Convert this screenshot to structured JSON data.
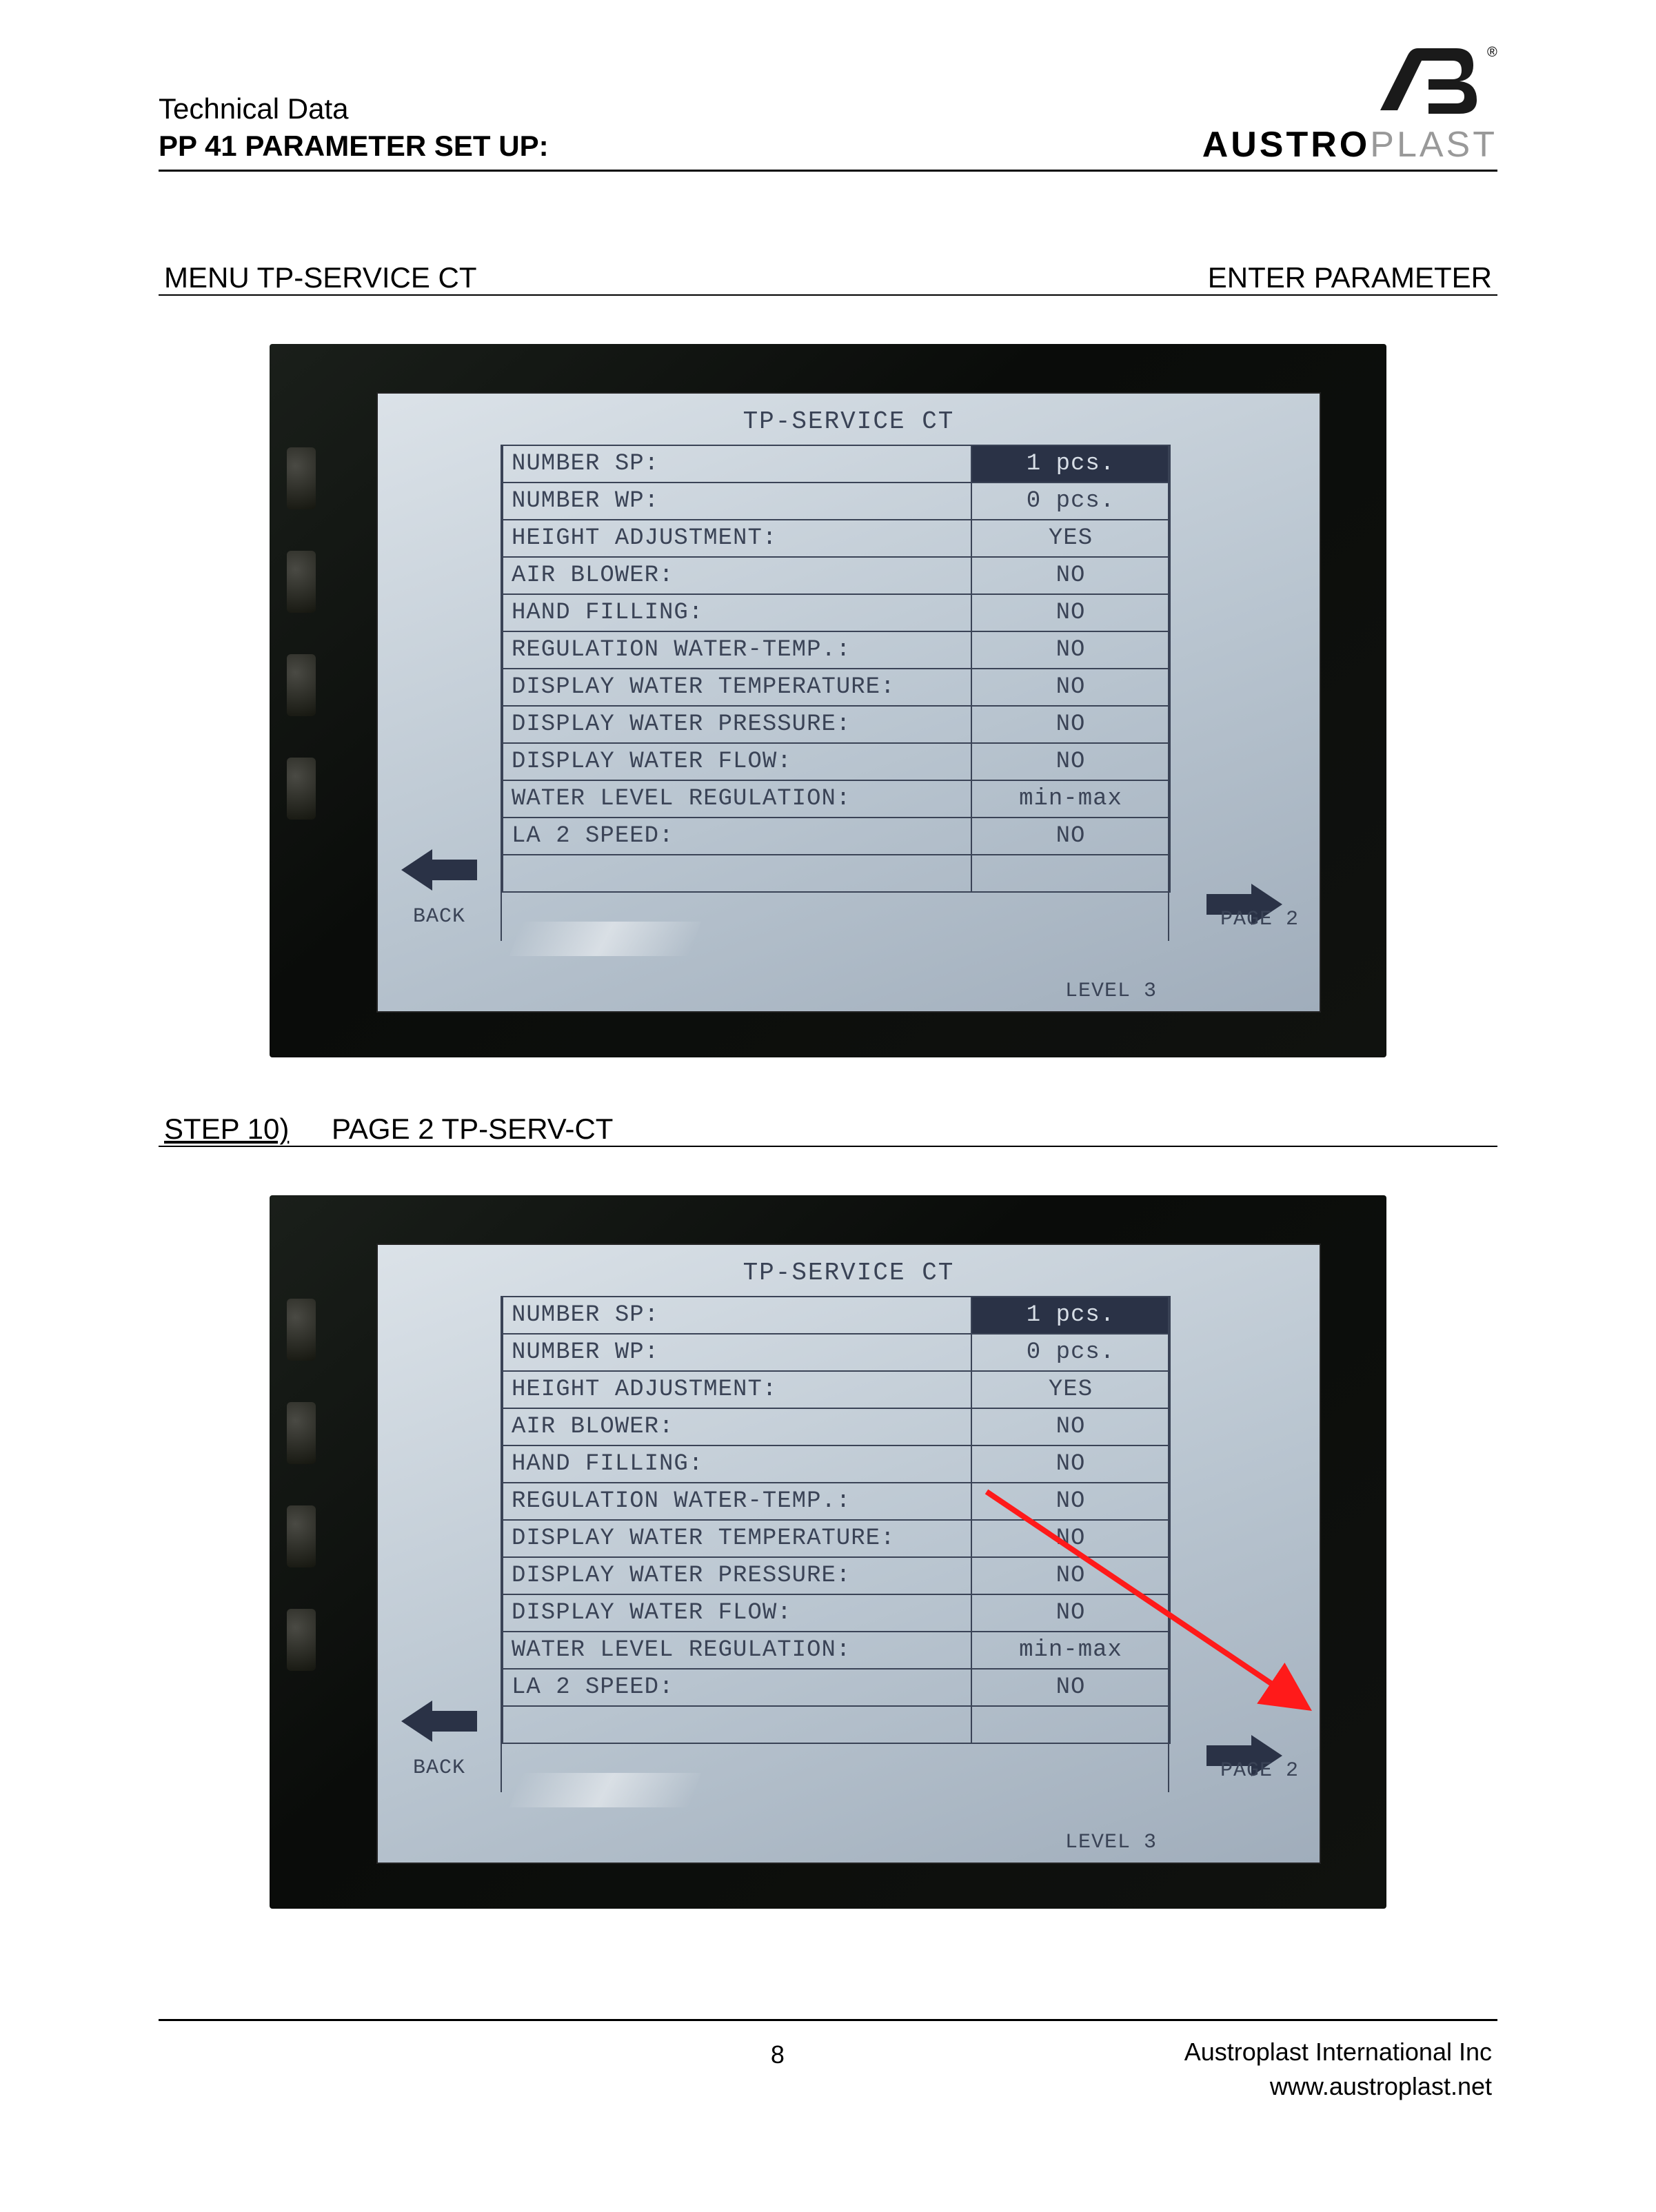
{
  "header": {
    "line1": "Technical Data",
    "line2": "PP 41 PARAMETER SET UP:",
    "brand_bold": "AUSTRO",
    "brand_light": "PLAST",
    "registered": "®"
  },
  "section1": {
    "left": "MENU TP-SERVICE CT",
    "right": "ENTER PARAMETER"
  },
  "section2": {
    "step": "STEP 10)",
    "title": "PAGE 2 TP-SERV-CT"
  },
  "screen": {
    "title": "TP-SERVICE CT",
    "rows": [
      {
        "label": "NUMBER SP:",
        "value": "1 pcs.",
        "highlight": true
      },
      {
        "label": "NUMBER WP:",
        "value": "0 pcs."
      },
      {
        "label": "HEIGHT ADJUSTMENT:",
        "value": "YES"
      },
      {
        "label": "AIR BLOWER:",
        "value": "NO"
      },
      {
        "label": "HAND FILLING:",
        "value": "NO"
      },
      {
        "label": "REGULATION WATER-TEMP.:",
        "value": "NO"
      },
      {
        "label": "DISPLAY WATER TEMPERATURE:",
        "value": "NO"
      },
      {
        "label": "DISPLAY WATER PRESSURE:",
        "value": "NO"
      },
      {
        "label": "DISPLAY WATER FLOW:",
        "value": "NO"
      },
      {
        "label": "WATER LEVEL REGULATION:",
        "value": "min-max"
      },
      {
        "label": "LA 2 SPEED:",
        "value": "NO"
      }
    ],
    "back": "BACK",
    "level": "LEVEL 3",
    "page": "PAGE 2"
  },
  "footer": {
    "page_number": "8",
    "company": "Austroplast International Inc",
    "site": "www.austroplast.net"
  }
}
